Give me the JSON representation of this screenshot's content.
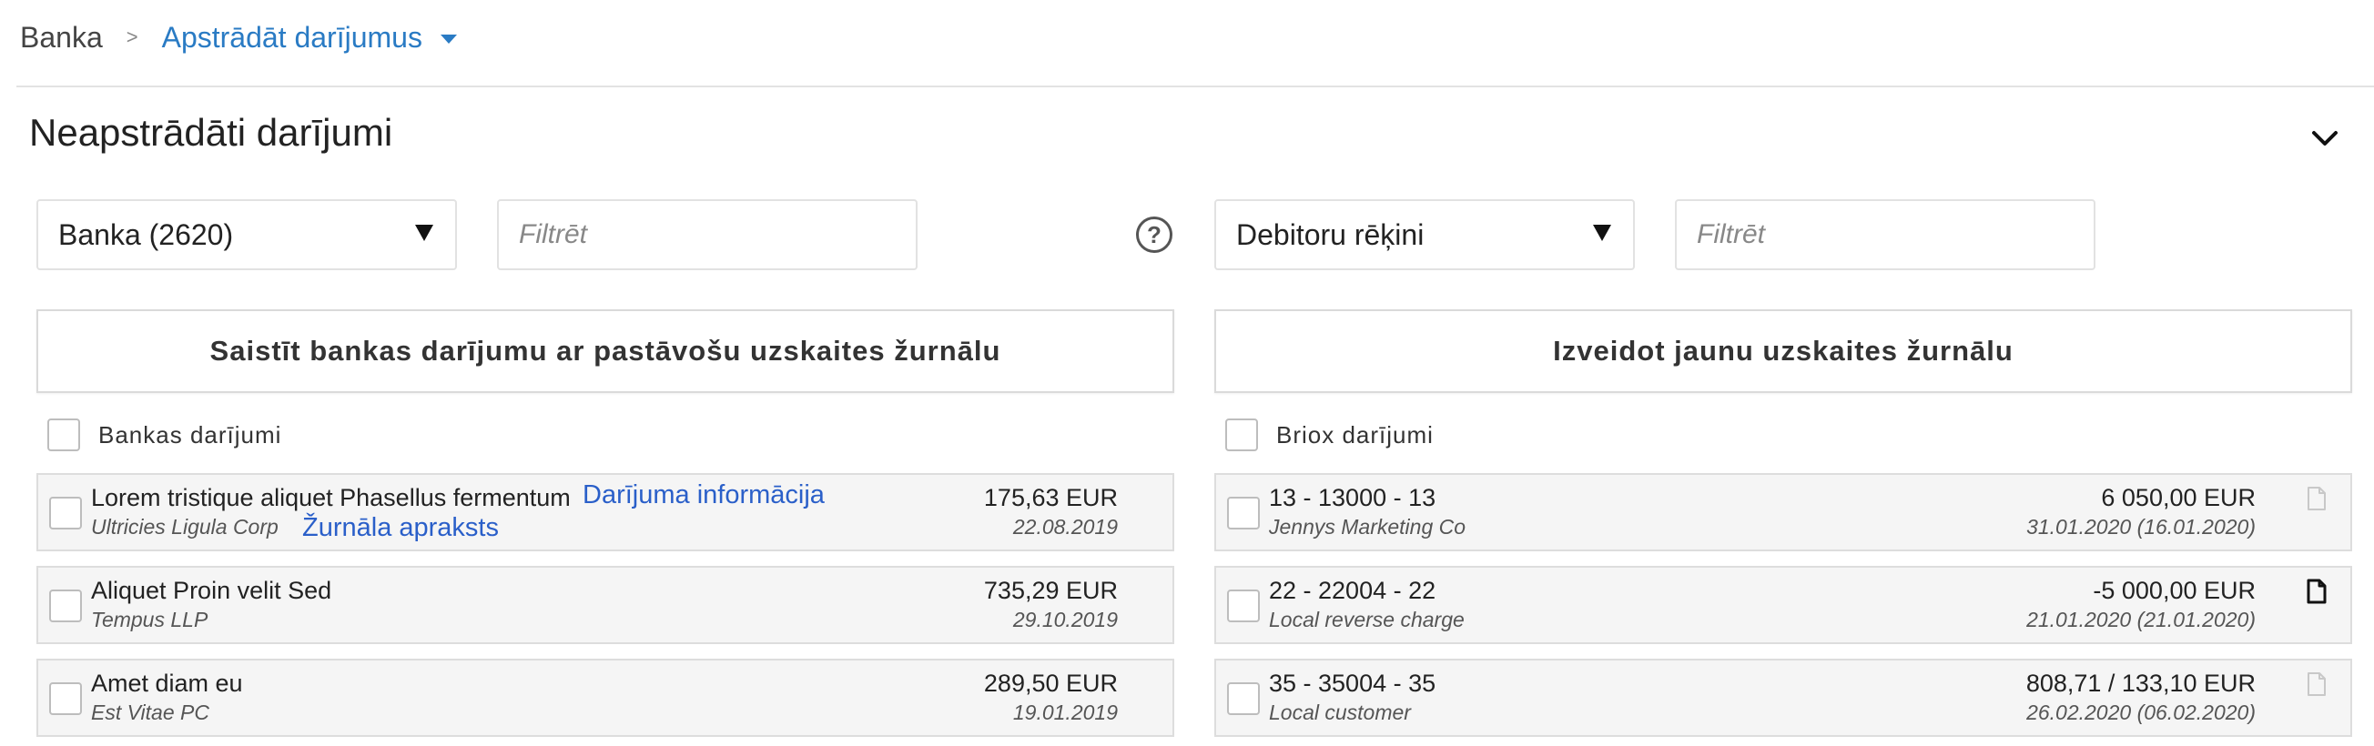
{
  "breadcrumb": {
    "root": "Banka",
    "separator": ">",
    "current": "Apstrādāt darījumus"
  },
  "section": {
    "title": "Neapstrādāti darījumi"
  },
  "left": {
    "account_select": "Banka (2620)",
    "filter_placeholder": "Filtrēt",
    "action_label": "Saistīt bankas darījumu ar pastāvošu uzskaites žurnālu",
    "list_header": "Bankas darījumi",
    "rows": [
      {
        "title": "Lorem tristique aliquet Phasellus fermentum",
        "subtitle": "Ultricies Ligula Corp",
        "amount": "175,63 EUR",
        "date": "22.08.2019",
        "link_info": "Darījuma informācija",
        "link_journal": "Žurnāla apraksts"
      },
      {
        "title": "Aliquet Proin velit Sed",
        "subtitle": "Tempus LLP",
        "amount": "735,29 EUR",
        "date": "29.10.2019"
      },
      {
        "title": "Amet diam eu",
        "subtitle": "Est Vitae PC",
        "amount": "289,50 EUR",
        "date": "19.01.2019"
      }
    ]
  },
  "right": {
    "type_select": "Debitoru rēķini",
    "filter_placeholder": "Filtrēt",
    "action_label": "Izveidot jaunu uzskaites žurnālu",
    "list_header": "Briox darījumi",
    "rows": [
      {
        "title": "13 - 13000 - 13",
        "subtitle": "Jennys Marketing Co",
        "amount": "6 050,00 EUR",
        "date": "31.01.2020 (16.01.2020)",
        "doc_icon": "document-outline-icon"
      },
      {
        "title": "22 - 22004 - 22",
        "subtitle": "Local reverse charge",
        "amount": "-5 000,00 EUR",
        "date": "21.01.2020 (21.01.2020)",
        "doc_icon": "document-icon"
      },
      {
        "title": "35 - 35004 - 35",
        "subtitle": "Local customer",
        "amount": "808,71 / 133,10 EUR",
        "date": "26.02.2020 (06.02.2020)",
        "doc_icon": "document-outline-icon"
      }
    ]
  },
  "colors": {
    "link": "#2a5fc9",
    "breadcrumb_accent": "#2a7bc4",
    "row_bg": "#f5f5f5"
  }
}
